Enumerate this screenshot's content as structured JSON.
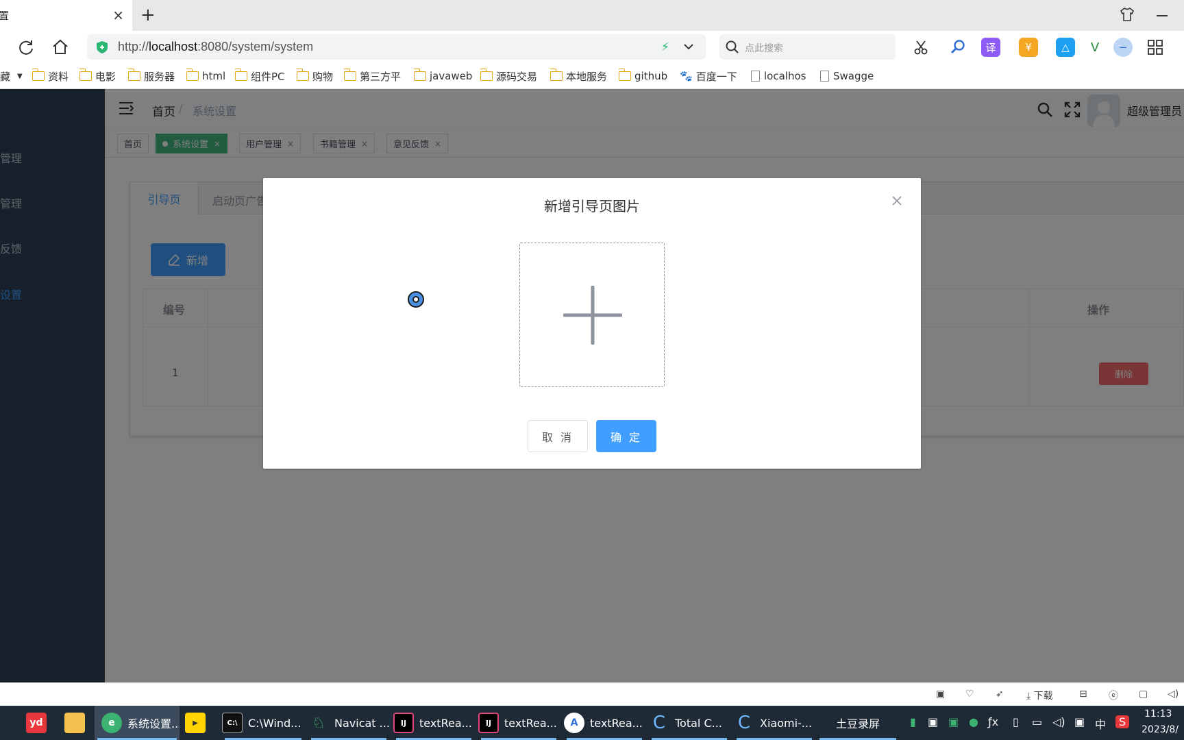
{
  "browser": {
    "tab_title": "置",
    "tab_close": "×",
    "new_tab": "+",
    "url_scheme": "http://",
    "url_host": "localhost",
    "url_rest": ":8080/system/system",
    "search_placeholder": "点此搜索",
    "bookmarks": [
      {
        "label": "藏",
        "type": "partial"
      },
      {
        "label": "资料",
        "type": "folder"
      },
      {
        "label": "电影",
        "type": "folder"
      },
      {
        "label": "服务器",
        "type": "folder"
      },
      {
        "label": "html",
        "type": "folder"
      },
      {
        "label": "组件PC",
        "type": "folder"
      },
      {
        "label": "购物",
        "type": "folder"
      },
      {
        "label": "第三方平",
        "type": "folder"
      },
      {
        "label": "javaweb",
        "type": "folder"
      },
      {
        "label": "源码交易",
        "type": "folder"
      },
      {
        "label": "本地服务",
        "type": "folder"
      },
      {
        "label": "github",
        "type": "folder"
      },
      {
        "label": "百度一下",
        "type": "baidu"
      },
      {
        "label": "localhos",
        "type": "doc"
      },
      {
        "label": "Swagge",
        "type": "doc"
      }
    ]
  },
  "sidebar": {
    "items": [
      "管理",
      "管理",
      "反馈",
      "设置"
    ]
  },
  "header": {
    "breadcrumb_home": "首页",
    "breadcrumb_sep": "/",
    "breadcrumb_current": "系统设置",
    "user_name": "超级管理员"
  },
  "tags": [
    {
      "label": "首页"
    },
    {
      "label": "系统设置",
      "close": "×"
    },
    {
      "label": "用户管理",
      "close": "×"
    },
    {
      "label": "书籍管理",
      "close": "×"
    },
    {
      "label": "意见反馈",
      "close": "×"
    }
  ],
  "page": {
    "tab_guide": "引导页",
    "tab_splash": "启动页广告",
    "add_button": "新增",
    "col_no": "编号",
    "col_actions": "操作",
    "row_no": "1",
    "delete_button": "删除"
  },
  "dialog": {
    "title": "新增引导页图片",
    "cancel": "取 消",
    "confirm": "确 定"
  },
  "statusbar": {
    "download": "下载"
  },
  "taskbar": {
    "items": [
      "系统设置...",
      "C:\\Wind...",
      "Navicat ...",
      "textRea...",
      "textRea...",
      "textRea...",
      "Total C...",
      "Xiaomi-...",
      "土豆录屏"
    ],
    "ime": "中",
    "time": "11:13",
    "date": "2023/8/"
  },
  "colors": {
    "primary": "#409eff",
    "tag_active": "#42b983",
    "danger": "#f56c6c",
    "sidebar_bg": "#304156"
  }
}
